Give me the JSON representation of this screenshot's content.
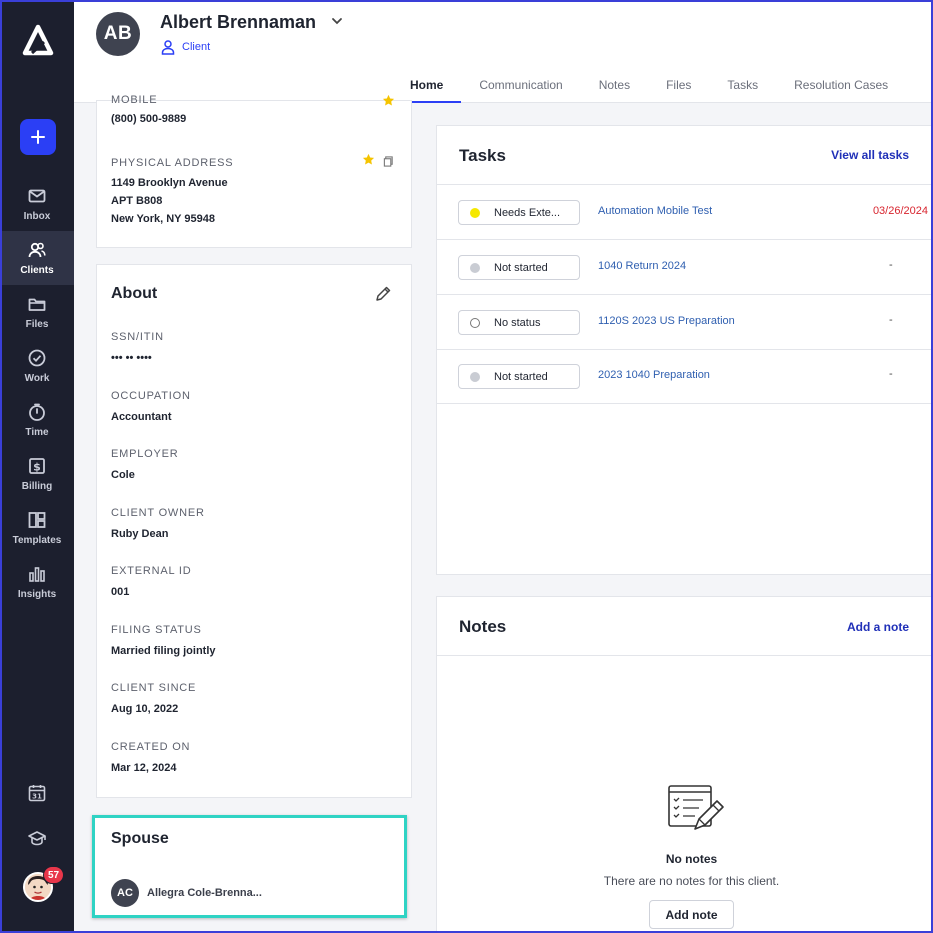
{
  "sidebar": {
    "items": [
      {
        "label": "Inbox",
        "icon": "mail-icon"
      },
      {
        "label": "Clients",
        "icon": "clients-icon",
        "active": true
      },
      {
        "label": "Files",
        "icon": "folder-icon"
      },
      {
        "label": "Work",
        "icon": "check-circle-icon"
      },
      {
        "label": "Time",
        "icon": "timer-icon"
      },
      {
        "label": "Billing",
        "icon": "billing-icon"
      },
      {
        "label": "Templates",
        "icon": "templates-icon"
      },
      {
        "label": "Insights",
        "icon": "bar-chart-icon"
      }
    ],
    "calendar_day": "31",
    "notification_count": "57"
  },
  "header": {
    "initials": "AB",
    "name": "Albert Brennaman",
    "client_type": "Client",
    "tabs": [
      "Home",
      "Communication",
      "Notes",
      "Files",
      "Tasks",
      "Resolution Cases"
    ],
    "active_tab": "Home"
  },
  "contact": {
    "phone_label_partial": "MOBILE",
    "phone": "(800) 500-9889",
    "address_label": "PHYSICAL ADDRESS",
    "address_line1": "1149 Brooklyn Avenue",
    "address_line2": "APT B808",
    "address_line3": "New York, NY 95948"
  },
  "about": {
    "title": "About",
    "fields": [
      {
        "label": "SSN/ITIN",
        "value": "••• •• ••••"
      },
      {
        "label": "OCCUPATION",
        "value": "Accountant"
      },
      {
        "label": "EMPLOYER",
        "value": "Cole"
      },
      {
        "label": "CLIENT OWNER",
        "value": "Ruby Dean"
      },
      {
        "label": "EXTERNAL ID",
        "value": "001"
      },
      {
        "label": "FILING STATUS",
        "value": "Married filing jointly"
      },
      {
        "label": "CLIENT SINCE",
        "value": "Aug 10, 2022"
      },
      {
        "label": "CREATED ON",
        "value": "Mar 12, 2024"
      }
    ]
  },
  "spouse": {
    "title": "Spouse",
    "initials": "AC",
    "name": "Allegra Cole-Brenna..."
  },
  "tasks": {
    "title": "Tasks",
    "view_all": "View all tasks",
    "rows": [
      {
        "status": "Needs Exte...",
        "dot_color": "#f5e800",
        "dot_style": "filled",
        "name": "Automation Mobile Test",
        "due": "03/26/2024"
      },
      {
        "status": "Not started",
        "dot_color": "#c9ccd3",
        "dot_style": "filled",
        "name": "1040 Return 2024",
        "due": "-"
      },
      {
        "status": "No status",
        "dot_color": "#ffffff",
        "dot_style": "outline",
        "name": "1120S 2023 US Preparation",
        "due": "-"
      },
      {
        "status": "Not started",
        "dot_color": "#c9ccd3",
        "dot_style": "filled",
        "name": "2023 1040 Preparation",
        "due": "-"
      }
    ]
  },
  "notes": {
    "title": "Notes",
    "add_link": "Add a note",
    "empty_title": "No notes",
    "empty_sub": "There are no notes for this client.",
    "add_button": "Add note"
  }
}
